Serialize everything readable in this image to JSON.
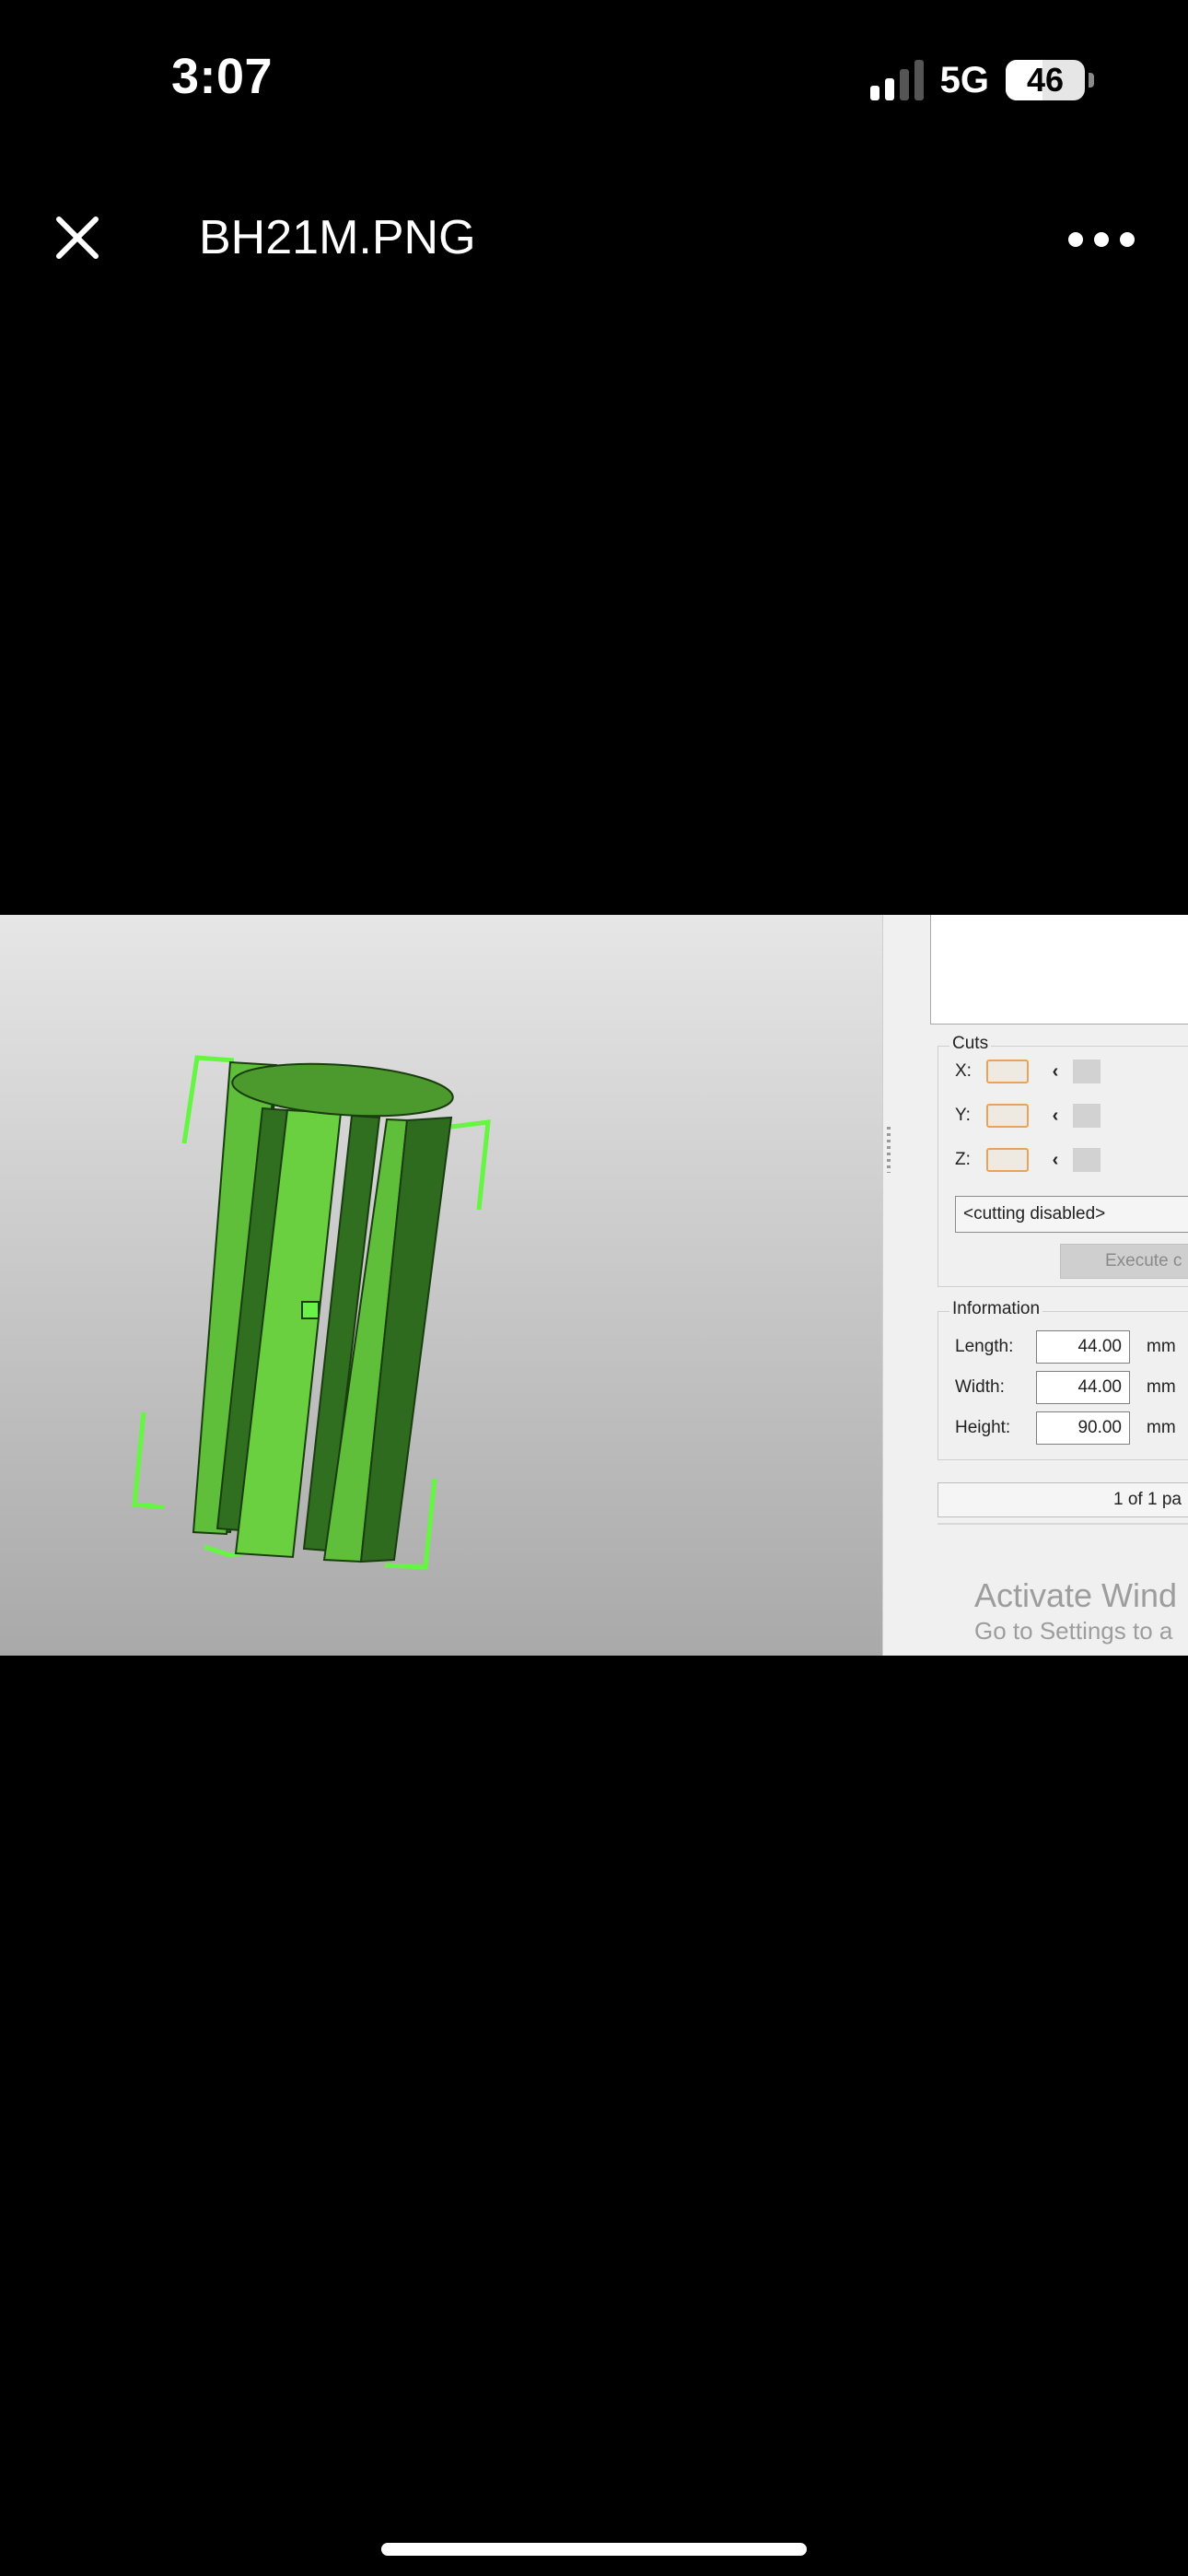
{
  "status_bar": {
    "time": "3:07",
    "network": "5G",
    "battery": "46",
    "icons": [
      "signal-icon",
      "battery-icon"
    ]
  },
  "viewer": {
    "title": "BH21M.PNG",
    "close_icon": "close-icon",
    "more_icon": "more-icon"
  },
  "screenshot": {
    "cuts": {
      "title": "Cuts",
      "axes": [
        {
          "label": "X:"
        },
        {
          "label": "Y:"
        },
        {
          "label": "Z:"
        }
      ],
      "dropdown_value": "<cutting disabled>",
      "execute_label": "Execute c"
    },
    "information": {
      "title": "Information",
      "rows": [
        {
          "label": "Length:",
          "value": "44.00",
          "unit": "mm"
        },
        {
          "label": "Width:",
          "value": "44.00",
          "unit": "mm"
        },
        {
          "label": "Height:",
          "value": "90.00",
          "unit": "mm"
        }
      ]
    },
    "page_indicator": "1 of 1 pa",
    "watermark": {
      "title": "Activate Wind",
      "subtitle": "Go to Settings to a"
    },
    "model_color": "#5fbf3a",
    "viewport_colors": {
      "top": "#e6e6e6",
      "bottom": "#a9a9a9"
    }
  }
}
